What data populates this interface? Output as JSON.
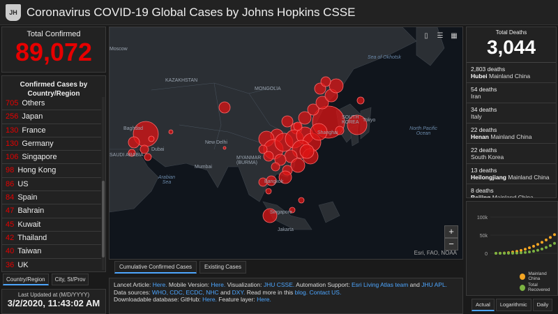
{
  "header": {
    "title": "Coronavirus COVID-19 Global Cases by Johns Hopkins CSSE"
  },
  "total_confirmed": {
    "label": "Total Confirmed",
    "value": "89,072"
  },
  "country_panel": {
    "heading": "Confirmed Cases by Country/Region",
    "rows": [
      {
        "num": "705",
        "name": "Others"
      },
      {
        "num": "256",
        "name": "Japan"
      },
      {
        "num": "130",
        "name": "France"
      },
      {
        "num": "130",
        "name": "Germany"
      },
      {
        "num": "106",
        "name": "Singapore"
      },
      {
        "num": "98",
        "name": "Hong Kong"
      },
      {
        "num": "86",
        "name": "US"
      },
      {
        "num": "84",
        "name": "Spain"
      },
      {
        "num": "47",
        "name": "Bahrain"
      },
      {
        "num": "45",
        "name": "Kuwait"
      },
      {
        "num": "42",
        "name": "Thailand"
      },
      {
        "num": "40",
        "name": "Taiwan"
      },
      {
        "num": "36",
        "name": "UK"
      }
    ],
    "tabs": [
      "Country/Region",
      "City, St/Prov"
    ]
  },
  "updated": {
    "label": "Last Updated at (M/D/YYYY)",
    "value": "3/2/2020, 11:43:02 AM"
  },
  "map": {
    "labels": {
      "moscow": "Moscow",
      "kazakhstan": "KAZAKHSTAN",
      "mongolia": "MONGOLIA",
      "sea_okhotsk": "Sea of Okhotsk",
      "north_pacific": "North Pacific Ocean",
      "baghdad": "Baghdad",
      "saudi": "SAUDI ARABIA",
      "dubai": "Dubai",
      "new_delhi": "New Delhi",
      "myanmar": "MYANMAR (BURMA)",
      "mumbai": "Mumbai",
      "arabian_sea": "Arabian Sea",
      "bangkok": "Bangkok",
      "singapore": "Singapore",
      "jakarta": "Jakarta",
      "south_korea": "SOUTH KOREA",
      "tokyo": "Tokyo",
      "shanghai": "Shanghai"
    },
    "attribution": "Esri, FAO, NOAA",
    "zoom_in": "+",
    "zoom_out": "−",
    "tabs": [
      "Cumulative Confirmed Cases",
      "Existing Cases"
    ]
  },
  "info": {
    "t1": "Lancet Article: ",
    "l1": "Here.",
    "t2": " Mobile Version: ",
    "l2": "Here.",
    "t3": " Visualization: ",
    "l3": "JHU CSSE.",
    "t4": " Automation Support: ",
    "l4": "Esri Living Atlas team",
    "t5": " and ",
    "l5": "JHU APL.",
    "t6": "Data sources: ",
    "l6": "WHO, CDC, ECDC, NHC",
    "t7": " and ",
    "l7": "DXY.",
    "t8": " Read more in this ",
    "l8": "blog.",
    "t9": " ",
    "l9": "Contact US.",
    "t10": "Downloadable database: GitHub: ",
    "l10": "Here.",
    "t11": " Feature layer: ",
    "l11": "Here."
  },
  "deaths": {
    "label": "Total Deaths",
    "value": "3,044",
    "rows": [
      {
        "count": "2,803 deaths",
        "place": "Hubei",
        "region": "Mainland China"
      },
      {
        "count": "54 deaths",
        "place": "",
        "region": "Iran"
      },
      {
        "count": "34 deaths",
        "place": "",
        "region": "Italy"
      },
      {
        "count": "22 deaths",
        "place": "Henan",
        "region": "Mainland China"
      },
      {
        "count": "22 deaths",
        "place": "",
        "region": "South Korea"
      },
      {
        "count": "13 deaths",
        "place": "Heilongjiang",
        "region": "Mainland China"
      },
      {
        "count": "8 deaths",
        "place": "Beijing",
        "region": "Mainland China"
      }
    ]
  },
  "chart_data": {
    "type": "line",
    "y_ticks": [
      "100k",
      "50k",
      "0"
    ],
    "ylim": [
      0,
      100000
    ],
    "series": [
      {
        "name": "Mainland China",
        "color": "#f5a623"
      },
      {
        "name": "Total Recovered",
        "color": "#7cb342"
      }
    ]
  },
  "chart_tabs": [
    "Actual",
    "Logarithmic",
    "Daily"
  ],
  "colors": {
    "accent": "#e60000",
    "link": "#4da6ff"
  }
}
